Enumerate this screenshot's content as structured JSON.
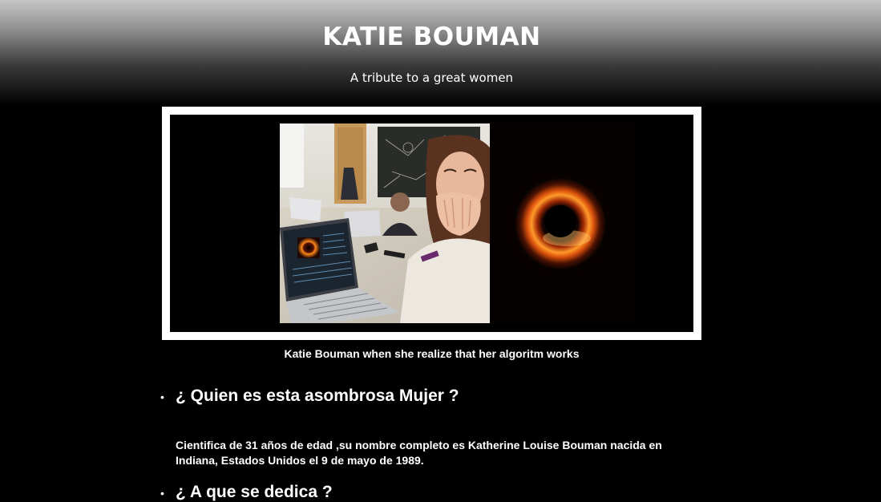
{
  "header": {
    "title": "KATIE BOUMAN",
    "subtitle": "A tribute to a great women"
  },
  "figure": {
    "caption": "Katie Bouman when she realize that her algoritm works"
  },
  "sections": [
    {
      "heading": "¿ Quien es esta asombrosa Mujer ?",
      "body": "Cientifica de 31 años de edad ,su nombre completo es Katherine Louise Bouman nacida en Indiana, Estados Unidos el 9 de mayo de 1989."
    },
    {
      "heading": "¿ A que se dedica ?"
    }
  ],
  "colors": {
    "background": "#000000",
    "text": "#ffffff",
    "frame": "#ffffff"
  }
}
